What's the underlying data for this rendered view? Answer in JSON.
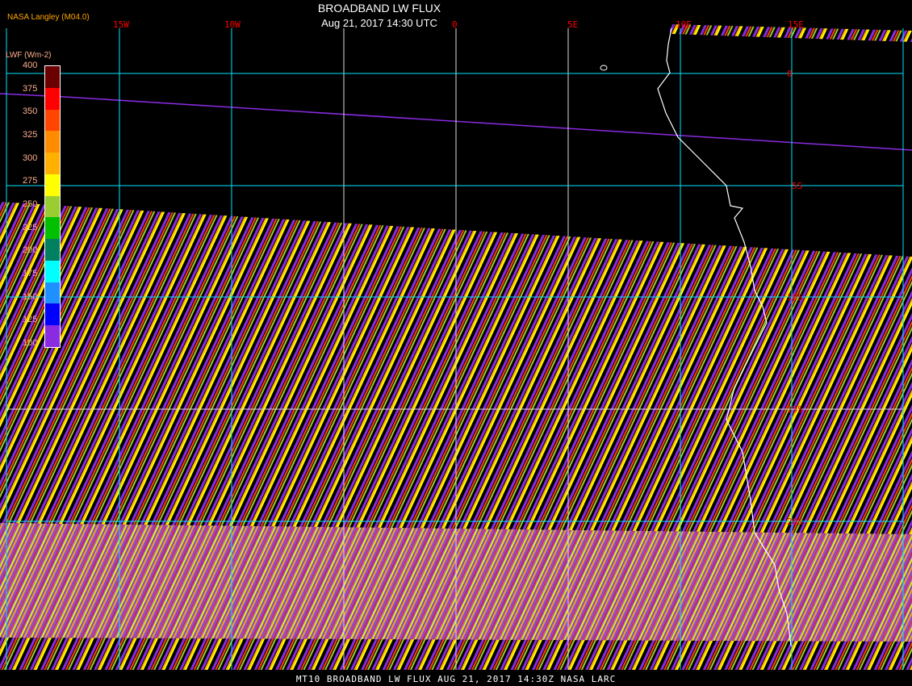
{
  "header": {
    "title": "BROADBAND LW FLUX",
    "subtitle": "Aug 21, 2017 14:30 UTC",
    "organization": "NASA Langley (M04.0)"
  },
  "legend": {
    "unit": "LWF (Wm-2)",
    "ticks": [
      "400",
      "375",
      "350",
      "325",
      "300",
      "275",
      "250",
      "225",
      "200",
      "175",
      "150",
      "125",
      "100"
    ],
    "colors": [
      "#6b0000",
      "#ff0000",
      "#ff4500",
      "#ff8c00",
      "#ffb000",
      "#ffff00",
      "#9acd32",
      "#00c000",
      "#008060",
      "#00ffff",
      "#1e90ff",
      "#0000ff",
      "#8a2be2"
    ]
  },
  "grid": {
    "lon_labels": [
      "15W",
      "10W",
      "0",
      "5E",
      "10E",
      "15E"
    ],
    "lat_labels": [
      "0",
      "5S",
      "10S",
      "15S",
      "20S"
    ]
  },
  "footer": "MT10  BROADBAND LW FLUX   AUG 21, 2017 14:30Z   NASA LARC"
}
